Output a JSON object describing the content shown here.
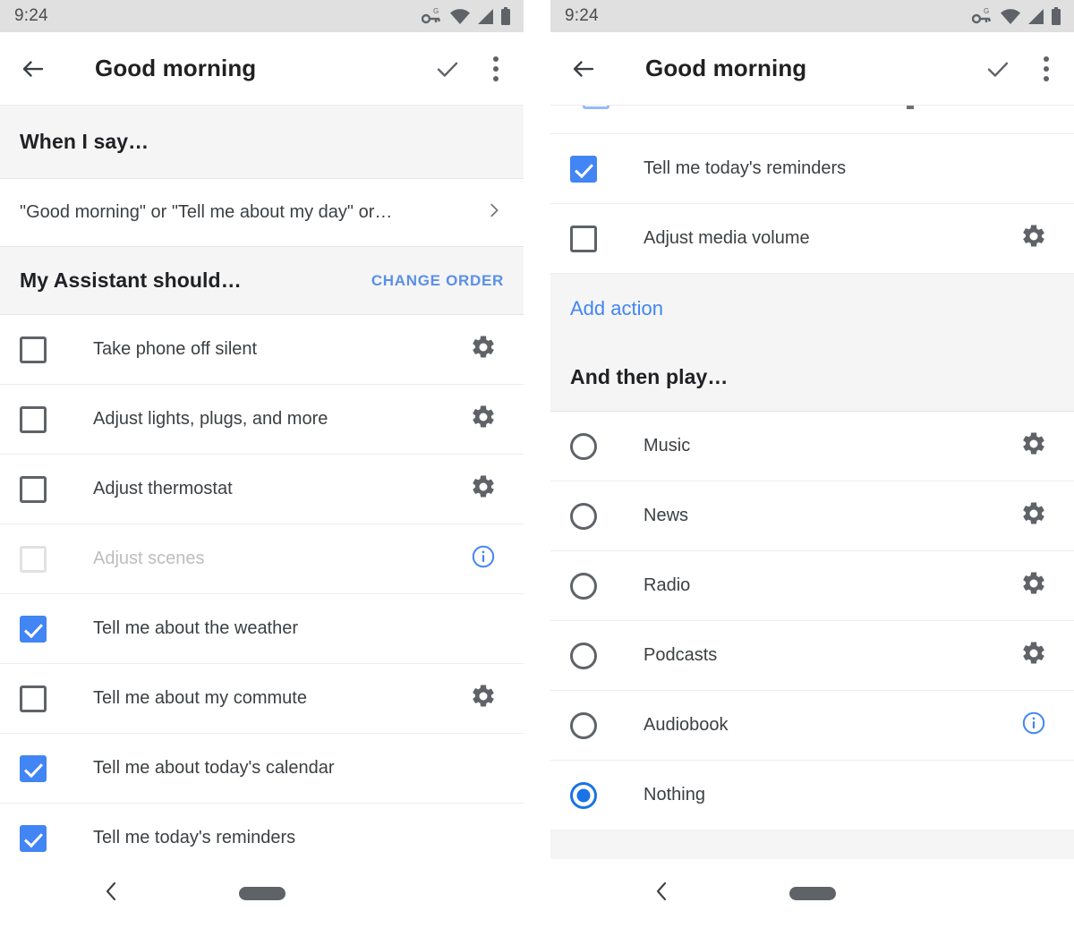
{
  "status_bar": {
    "time": "9:24",
    "icons": [
      "vpn-key-icon",
      "wifi-icon",
      "signal-icon",
      "battery-icon"
    ]
  },
  "app_bar": {
    "title": "Good morning",
    "back_icon": "back-arrow-icon",
    "confirm_icon": "check-icon",
    "overflow_icon": "more-vertical-icon"
  },
  "nav_bar": {
    "back_icon": "nav-back-icon",
    "home_pill": "home-pill"
  },
  "colors": {
    "accent_blue": "#4285f4",
    "link_blue": "#5b8fe8",
    "radio_blue": "#1a73e8",
    "section_bg": "#f5f5f5",
    "status_bg": "#e0e0e0",
    "text_primary": "#3c4043",
    "text_disabled": "#bdbdbd"
  },
  "left_screen": {
    "sections": {
      "when_i_say": "When I say…",
      "my_assistant_should": "My Assistant should…",
      "change_order": "CHANGE ORDER"
    },
    "phrase": {
      "text": "\"Good morning\" or \"Tell me about my day\" or…",
      "chevron": "chevron-right-icon"
    },
    "actions": [
      {
        "label": "Take phone off silent",
        "checked": false,
        "disabled": false,
        "trailing": "gear-icon"
      },
      {
        "label": "Adjust lights, plugs, and more",
        "checked": false,
        "disabled": false,
        "trailing": "gear-icon"
      },
      {
        "label": "Adjust thermostat",
        "checked": false,
        "disabled": false,
        "trailing": "gear-icon"
      },
      {
        "label": "Adjust scenes",
        "checked": false,
        "disabled": true,
        "trailing": "info-icon"
      },
      {
        "label": "Tell me about the weather",
        "checked": true,
        "disabled": false,
        "trailing": "none"
      },
      {
        "label": "Tell me about my commute",
        "checked": false,
        "disabled": false,
        "trailing": "gear-icon"
      },
      {
        "label": "Tell me about today's calendar",
        "checked": true,
        "disabled": false,
        "trailing": "none"
      },
      {
        "label": "Tell me today's reminders",
        "checked": true,
        "disabled": false,
        "trailing": "none"
      }
    ]
  },
  "right_screen": {
    "actions": [
      {
        "label": "Tell me today's reminders",
        "checked": true,
        "disabled": false,
        "trailing": "none"
      },
      {
        "label": "Adjust media volume",
        "checked": false,
        "disabled": false,
        "trailing": "gear-icon"
      }
    ],
    "add_action": "Add action",
    "and_then_play": "And then play…",
    "media_options": [
      {
        "label": "Music",
        "selected": false,
        "trailing": "gear-icon"
      },
      {
        "label": "News",
        "selected": false,
        "trailing": "gear-icon"
      },
      {
        "label": "Radio",
        "selected": false,
        "trailing": "gear-icon"
      },
      {
        "label": "Podcasts",
        "selected": false,
        "trailing": "gear-icon"
      },
      {
        "label": "Audiobook",
        "selected": false,
        "trailing": "info-icon"
      },
      {
        "label": "Nothing",
        "selected": true,
        "trailing": "none"
      }
    ]
  }
}
